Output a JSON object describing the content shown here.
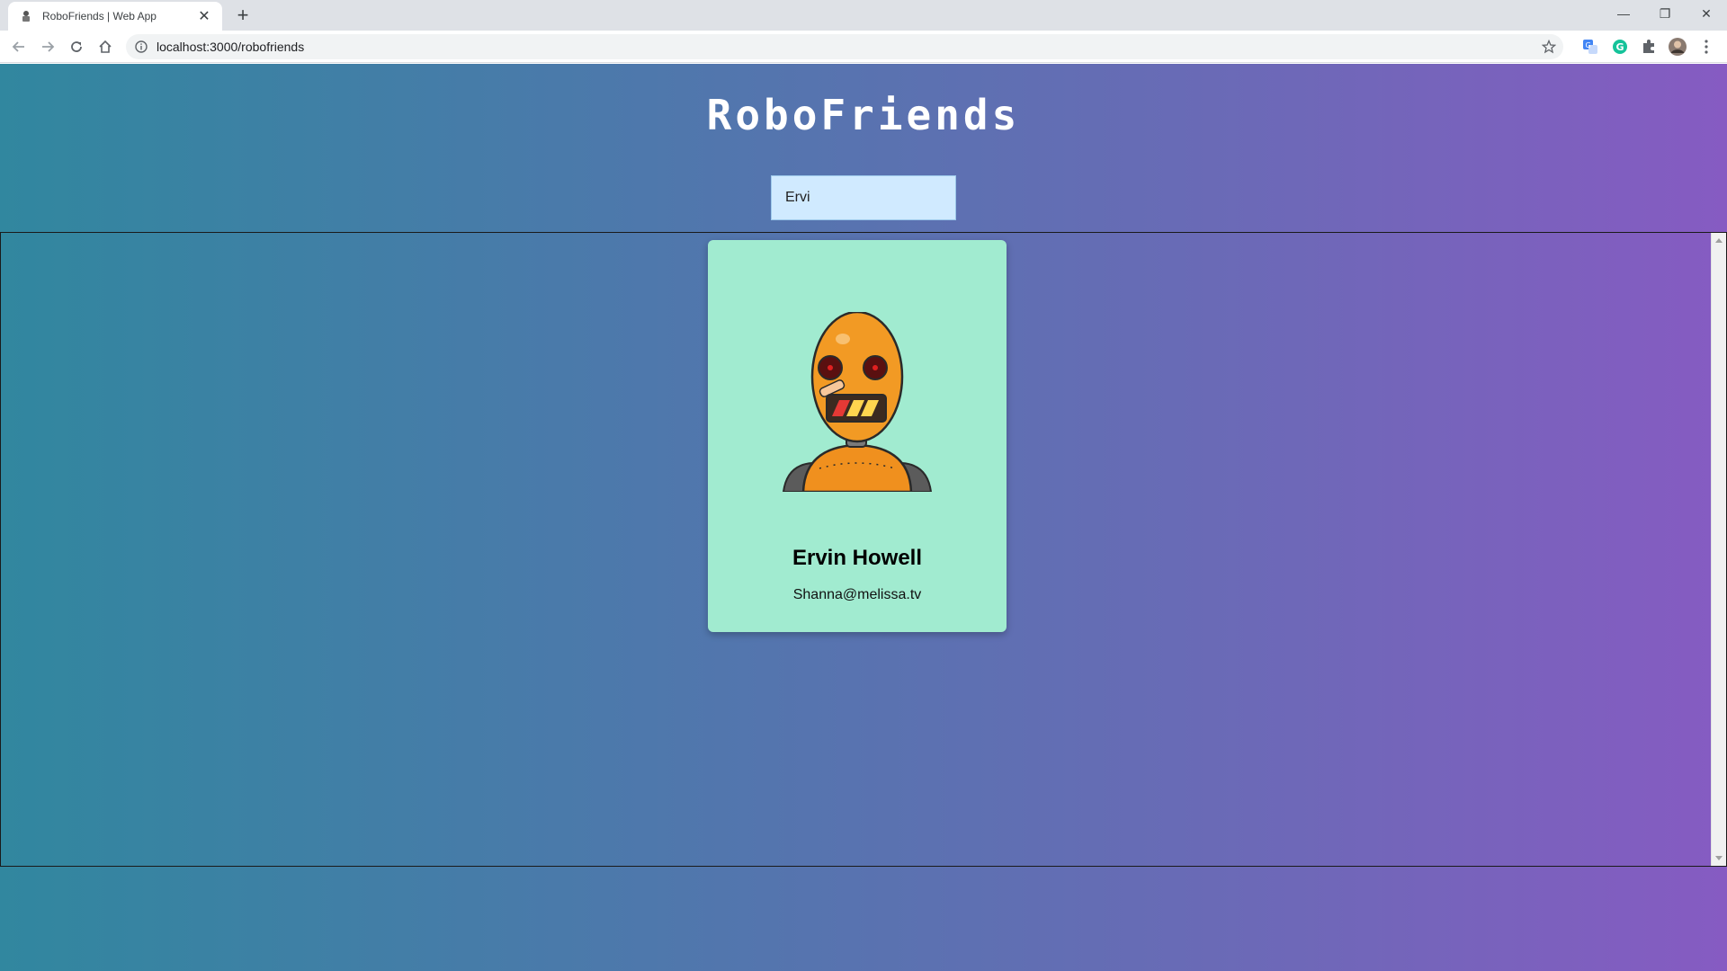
{
  "browser": {
    "tab_title": "RoboFriends | Web App",
    "url": "localhost:3000/robofriends"
  },
  "app": {
    "title": "RoboFriends",
    "search_value": "Ervi",
    "background_colors": [
      "#31879f",
      "#865bc2"
    ]
  },
  "robots": [
    {
      "name": "Ervin Howell",
      "email": "Shanna@melissa.tv",
      "card_color": "#a1ebd0"
    }
  ],
  "icons": {
    "tab_favicon": "robot-icon",
    "back": "back-arrow-icon",
    "forward": "forward-arrow-icon",
    "reload": "reload-icon",
    "home": "home-icon",
    "site_info": "info-icon",
    "bookmark": "star-icon",
    "extensions": [
      "translate-icon",
      "grammarly-icon",
      "puzzle-icon",
      "avatar"
    ],
    "menu": "kebab-menu-icon"
  }
}
